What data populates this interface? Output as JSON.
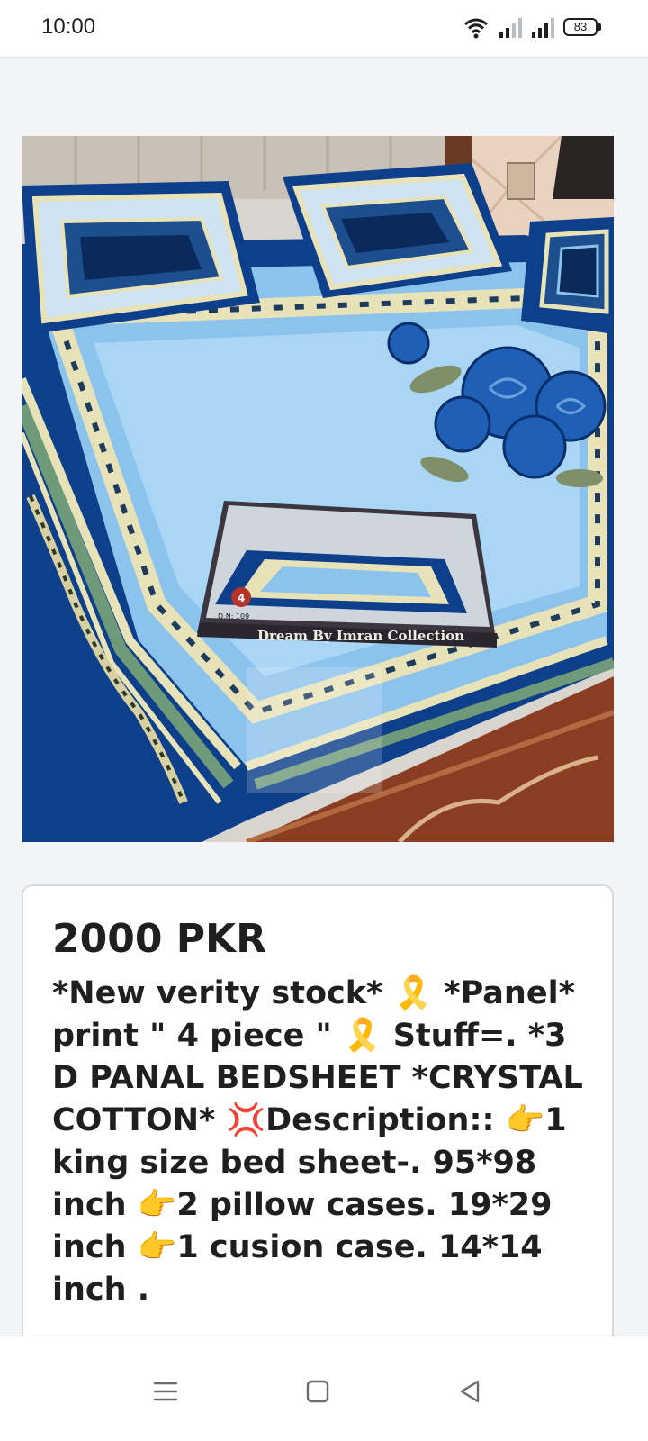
{
  "status_bar": {
    "time": "10:00",
    "battery": "83",
    "icons": [
      "wifi-icon",
      "signal-icon",
      "signal-icon",
      "battery-icon"
    ]
  },
  "product": {
    "image_package_label": "Dream By Imran Collection",
    "image_package_count": "4",
    "image_package_code": "D.N: 109",
    "price": "2000 PKR",
    "description": "*New verity stock* 🎗️ *Panel* print \" 4 piece \" 🎗️ Stuff=. *3 D PANAL BEDSHEET *CRYSTAL COTTON* 💢Description:: 👉1 king size bed sheet-. 95*98 inch 👉2 pillow cases. 19*29 inch 👉1 cusion case. 14*14 inch ."
  },
  "nav_bar": {
    "icons": [
      "menu-icon",
      "home-icon",
      "back-icon"
    ]
  },
  "colors": {
    "navy": "#0d3f8a",
    "sky": "#8cc3ec",
    "cream": "#e8e2b8",
    "wood": "#8a3d22"
  }
}
